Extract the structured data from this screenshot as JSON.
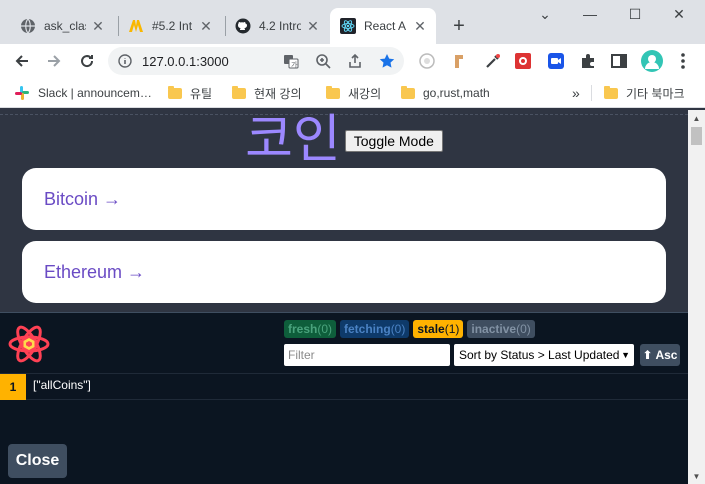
{
  "browser": {
    "tabs": [
      {
        "label": "ask_clas",
        "icon": "globe-icon",
        "active": false
      },
      {
        "label": "#5.2 Int",
        "icon": "m-logo-icon",
        "active": false
      },
      {
        "label": "4.2 Intro",
        "icon": "github-icon",
        "active": false
      },
      {
        "label": "React A",
        "icon": "react-icon",
        "active": true
      }
    ],
    "new_tab_label": "+",
    "url": "127.0.0.1:3000"
  },
  "bookmarks": [
    {
      "label": "Slack | announcem…",
      "icon": "slack-icon"
    },
    {
      "label": "유틸",
      "icon": "folder-icon"
    },
    {
      "label": "현재 강의",
      "icon": "folder-icon"
    },
    {
      "label": "새강의",
      "icon": "folder-icon"
    },
    {
      "label": "go,rust,math",
      "icon": "folder-icon"
    }
  ],
  "bookmarks_overflow": "»",
  "other_bookmarks": "기타 북마크",
  "page": {
    "title": "코인",
    "toggle_label": "Toggle Mode",
    "coins": [
      {
        "label": "Bitcoin →"
      },
      {
        "label": "Ethereum →"
      }
    ]
  },
  "devtools": {
    "badges": {
      "fresh": {
        "label": "fresh",
        "count": "(0)"
      },
      "fetching": {
        "label": "fetching",
        "count": "(0)"
      },
      "stale": {
        "label": "stale",
        "count": "(1)"
      },
      "inactive": {
        "label": "inactive",
        "count": "(0)"
      }
    },
    "filter_placeholder": "Filter",
    "sort_value": "Sort by Status > Last Updated",
    "asc_label": "⬆ Asc",
    "queries": [
      {
        "observers": "1",
        "key": "[\"allCoins\"]"
      }
    ],
    "close_label": "Close"
  },
  "colors": {
    "accent": "#9c88ff",
    "page_bg": "#2f3542",
    "devtools_bg": "#0b1521",
    "stale": "#ffb200"
  }
}
